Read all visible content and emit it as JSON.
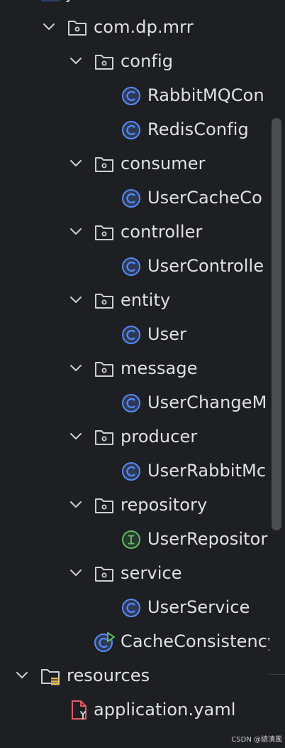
{
  "project_tree": {
    "items": [
      {
        "label": "java",
        "icon": "source-folder-icon",
        "expanded": true
      },
      {
        "label": "com.dp.mrr",
        "icon": "package-icon",
        "expanded": true
      },
      {
        "label": "config",
        "icon": "package-icon",
        "expanded": true
      },
      {
        "label": "RabbitMQCon",
        "icon": "class-icon"
      },
      {
        "label": "RedisConfig",
        "icon": "class-icon"
      },
      {
        "label": "consumer",
        "icon": "package-icon",
        "expanded": true
      },
      {
        "label": "UserCacheCo",
        "icon": "class-icon"
      },
      {
        "label": "controller",
        "icon": "package-icon",
        "expanded": true
      },
      {
        "label": "UserControlle",
        "icon": "class-icon"
      },
      {
        "label": "entity",
        "icon": "package-icon",
        "expanded": true
      },
      {
        "label": "User",
        "icon": "class-icon"
      },
      {
        "label": "message",
        "icon": "package-icon",
        "expanded": true
      },
      {
        "label": "UserChangeM",
        "icon": "class-icon"
      },
      {
        "label": "producer",
        "icon": "package-icon",
        "expanded": true
      },
      {
        "label": "UserRabbitMc",
        "icon": "class-icon"
      },
      {
        "label": "repository",
        "icon": "package-icon",
        "expanded": true
      },
      {
        "label": "UserRepositor",
        "icon": "interface-icon"
      },
      {
        "label": "service",
        "icon": "package-icon",
        "expanded": true
      },
      {
        "label": "UserService",
        "icon": "class-icon"
      },
      {
        "label": "CacheConsistencyF",
        "icon": "spring-boot-application-icon"
      },
      {
        "label": "resources",
        "icon": "resources-folder-icon",
        "expanded": true
      },
      {
        "label": "application.yaml",
        "icon": "yaml-file-icon"
      }
    ]
  },
  "watermark": "CSDN @總漬風",
  "colors": {
    "background": "#1e1f22",
    "text": "#dfe1e5",
    "class_icon": "#548af7",
    "interface_icon": "#5fb865",
    "yaml_icon": "#e55765",
    "folder_outline": "#ced0d6",
    "source_folder": "#4682fa"
  }
}
